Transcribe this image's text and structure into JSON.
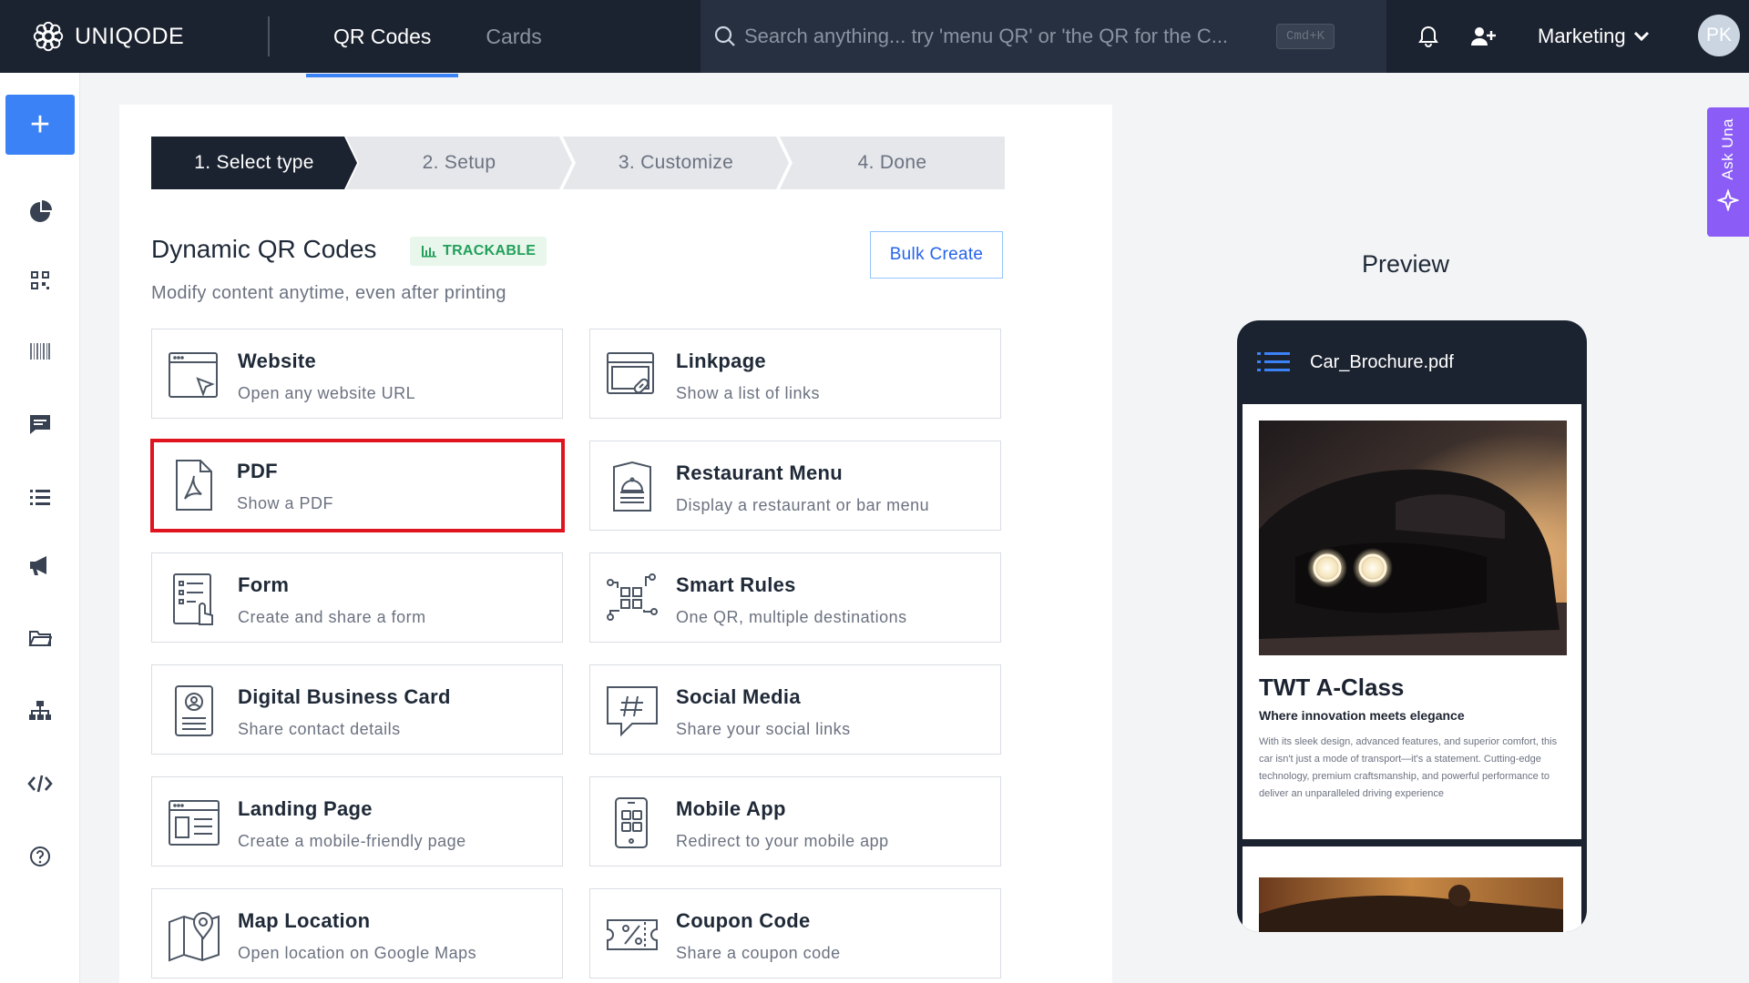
{
  "brand": {
    "name": "UNIQODE"
  },
  "nav": {
    "tabs": [
      {
        "label": "QR Codes",
        "active": true
      },
      {
        "label": "Cards",
        "active": false
      }
    ]
  },
  "search": {
    "placeholder": "Search anything... try 'menu QR' or 'the QR for the C...",
    "shortcut": "Cmd+K"
  },
  "header": {
    "workspace": "Marketing",
    "avatar_initials": "PK"
  },
  "sidebar": {
    "create_label": "+",
    "icons": [
      "analytics-icon",
      "qr-codes-icon",
      "barcode-icon",
      "messages-icon",
      "list-icon",
      "campaign-icon",
      "folder-icon",
      "hierarchy-icon",
      "code-icon",
      "help-icon"
    ]
  },
  "steps": [
    "1. Select type",
    "2. Setup",
    "3. Customize",
    "4. Done"
  ],
  "active_step": 0,
  "section": {
    "title": "Dynamic QR Codes",
    "badge": "TRACKABLE",
    "subtitle": "Modify content anytime, even after printing",
    "bulk_create": "Bulk Create"
  },
  "qr_types": [
    {
      "title": "Website",
      "desc": "Open any website URL",
      "icon": "website-icon"
    },
    {
      "title": "Linkpage",
      "desc": "Show a list of links",
      "icon": "linkpage-icon"
    },
    {
      "title": "PDF",
      "desc": "Show a PDF",
      "icon": "pdf-icon",
      "selected": true
    },
    {
      "title": "Restaurant Menu",
      "desc": "Display a restaurant or bar menu",
      "icon": "restaurant-menu-icon"
    },
    {
      "title": "Form",
      "desc": "Create and share a form",
      "icon": "form-icon"
    },
    {
      "title": "Smart Rules",
      "desc": "One QR, multiple destinations",
      "icon": "smart-rules-icon"
    },
    {
      "title": "Digital Business Card",
      "desc": "Share contact details",
      "icon": "business-card-icon"
    },
    {
      "title": "Social Media",
      "desc": "Share your social links",
      "icon": "social-media-icon"
    },
    {
      "title": "Landing Page",
      "desc": "Create a mobile-friendly page",
      "icon": "landing-page-icon"
    },
    {
      "title": "Mobile App",
      "desc": "Redirect to your mobile app",
      "icon": "mobile-app-icon"
    },
    {
      "title": "Map Location",
      "desc": "Open location on Google Maps",
      "icon": "map-location-icon"
    },
    {
      "title": "Coupon Code",
      "desc": "Share a coupon code",
      "icon": "coupon-code-icon"
    }
  ],
  "preview": {
    "title": "Preview",
    "file_name": "Car_Brochure.pdf",
    "doc_title": "TWT A-Class",
    "doc_tagline": "Where innovation meets elegance",
    "doc_body": "With its sleek design, advanced features, and superior comfort, this car isn't just a mode of transport—it's a statement. Cutting-edge technology, premium craftsmanship, and powerful performance to deliver an unparalleled driving experience"
  },
  "ask_una": {
    "label": "Ask Una"
  },
  "colors": {
    "topbar": "#1c2330",
    "accent": "#3b82f6",
    "selected_border": "#e0141e",
    "trackable": "#22a05a",
    "ask_una": "#8b5cf6"
  }
}
